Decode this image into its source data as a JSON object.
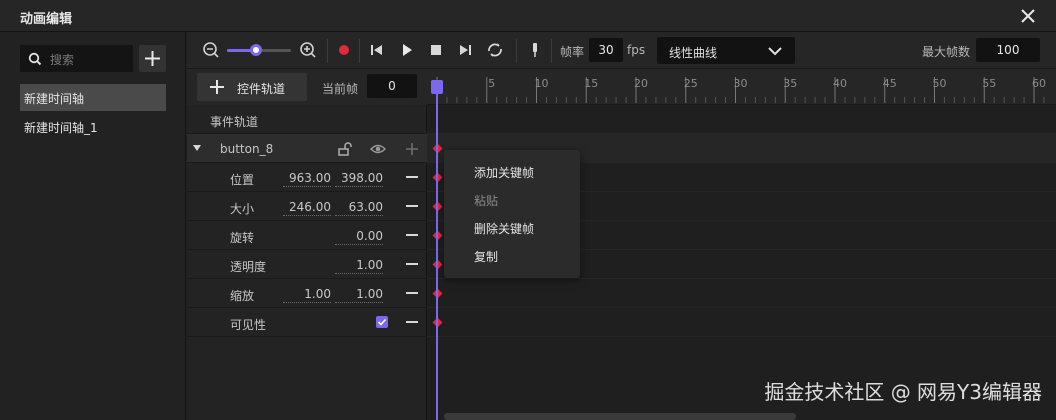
{
  "window": {
    "title": "动画编辑"
  },
  "sidebar": {
    "search_placeholder": "搜索",
    "timelines": [
      "新建时间轴",
      "新建时间轴_1"
    ]
  },
  "toolbar": {
    "frame_rate_label": "帧率",
    "frame_rate": "30",
    "fps_unit": "fps",
    "curve": "线性曲线",
    "max_frames_label": "最大帧数",
    "max_frames": "100",
    "zoom_level": 0.45
  },
  "subbar": {
    "add_track_label": "控件轨道",
    "current_frame_label": "当前帧",
    "current_frame": "0"
  },
  "ruler": {
    "ticks": [
      "5",
      "10",
      "15",
      "20",
      "25",
      "30",
      "35",
      "40",
      "45",
      "50",
      "55",
      "60"
    ]
  },
  "tracks": {
    "event_track": "事件轨道",
    "control_name": "button_8",
    "properties": [
      {
        "label": "位置",
        "v1": "963.00",
        "v2": "398.00"
      },
      {
        "label": "大小",
        "v1": "246.00",
        "v2": "63.00"
      },
      {
        "label": "旋转",
        "v1": "",
        "v2": "0.00"
      },
      {
        "label": "透明度",
        "v1": "",
        "v2": "1.00"
      },
      {
        "label": "缩放",
        "v1": "1.00",
        "v2": "1.00"
      },
      {
        "label": "可见性",
        "v1": "",
        "v2": ""
      }
    ]
  },
  "context_menu": {
    "items": [
      "添加关键帧",
      "粘贴",
      "删除关键帧",
      "复制"
    ],
    "disabled": [
      false,
      true,
      false,
      false
    ]
  },
  "watermark": "掘金技术社区 @ 网易Y3编辑器",
  "colors": {
    "accent": "#7c68ee",
    "keyframe": "#e2263e",
    "record": "#e02a3a"
  }
}
